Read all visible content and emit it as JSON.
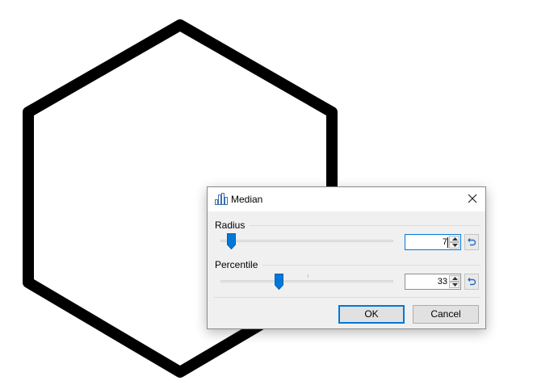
{
  "dialog": {
    "title": "Median",
    "title_icon": "histogram-icon",
    "close_icon": "close-icon"
  },
  "radius": {
    "label": "Radius",
    "value": "7",
    "slider_fraction": 0.04,
    "reset_icon": "reset-icon"
  },
  "percentile": {
    "label": "Percentile",
    "value": "33",
    "slider_fraction": 0.33,
    "reset_icon": "reset-icon"
  },
  "buttons": {
    "ok": "OK",
    "cancel": "Cancel"
  },
  "colors": {
    "accent": "#0078d7",
    "shape_stroke": "#000000"
  }
}
